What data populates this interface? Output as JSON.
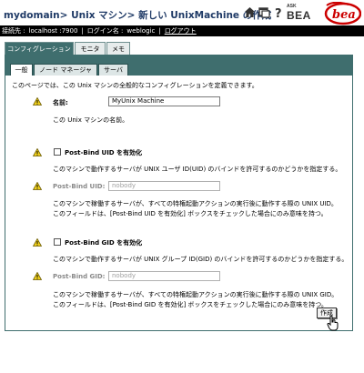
{
  "header": {
    "breadcrumb": {
      "domain": "mydomain",
      "sep1": ">",
      "section": "Unix マシン",
      "sep2": ">",
      "current": "新しい UnixMachine の作成"
    },
    "icons": [
      "home-icon",
      "window-icon",
      "help-icon"
    ],
    "logo_ask": "ASK",
    "logo_bea": "BEA",
    "logo_red_text": "bea"
  },
  "infobar": {
    "connect_label": "接続先 :",
    "connect_value": "localhost :7900",
    "sep1": "|",
    "login_label": "ログイン名 :",
    "login_value": "weblogic",
    "sep2": "|",
    "logout": "ログアウト"
  },
  "tabs": {
    "main": [
      {
        "label": "コンフィグレーション",
        "active": true
      },
      {
        "label": "モニタ",
        "active": false
      },
      {
        "label": "メモ",
        "active": false
      }
    ],
    "sub": [
      {
        "label": "一般",
        "active": true
      },
      {
        "label": "ノード マネージャ",
        "active": false
      },
      {
        "label": "サーバ",
        "active": false
      }
    ]
  },
  "content": {
    "intro": "このページでは、この Unix マシンの全般的なコンフィグレーションを定義できます。",
    "name": {
      "label": "名前:",
      "value": "MyUnix Machine",
      "desc": "この Unix マシンの名前。"
    },
    "uid_enable": {
      "label": "Post-Bind UID を有効化",
      "checked": false,
      "desc": "このマシンで動作するサーバが UNIX ユーザ ID(UID) のバインドを許可するのかどうかを指定する。"
    },
    "uid": {
      "label": "Post-Bind UID:",
      "value": "nobody",
      "desc1": "このマシンで稼働するサーバが、すべての特権起動アクションの実行後に動作する際の UNIX UID。",
      "desc2": "このフィールドは、[Post-Bind UID を有効化] ボックスをチェックした場合にのみ意味を持つ。"
    },
    "gid_enable": {
      "label": "Post-Bind GID を有効化",
      "checked": false,
      "desc": "このマシンで動作するサーバが UNIX グループ ID(GID) のバインドを許可するのかどうかを指定する。"
    },
    "gid": {
      "label": "Post-Bind GID:",
      "value": "nobody",
      "desc1": "このマシンで稼働するサーバが、すべての特権起動アクションの実行後に動作する際の UNIX GID。",
      "desc2": "このフィールドは、[Post-Bind GID を有効化] ボックスをチェックした場合にのみ意味を持つ。"
    },
    "create_button": "作成"
  },
  "colors": {
    "panel": "#3f6e6e",
    "infobar": "#000000",
    "crumb": "#1f3a66",
    "warning": "#f2d21b"
  }
}
